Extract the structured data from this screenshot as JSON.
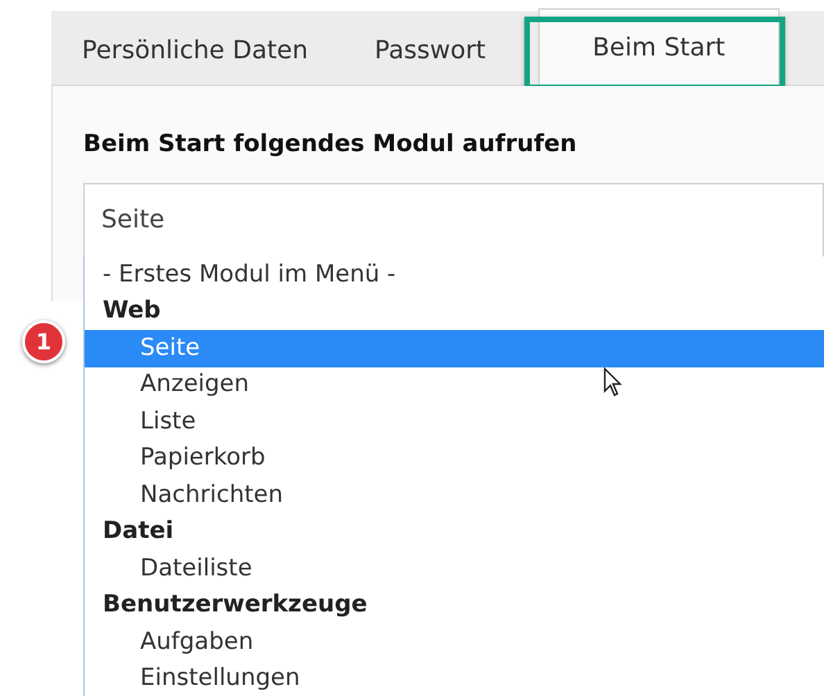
{
  "tabs": [
    {
      "label": "Persönliche Daten",
      "selected": false,
      "highlighted": false
    },
    {
      "label": "Passwort",
      "selected": false,
      "highlighted": false
    },
    {
      "label": "Beim Start",
      "selected": true,
      "highlighted": true
    }
  ],
  "field_label": "Beim Start folgendes Modul aufrufen",
  "select": {
    "value": "Seite",
    "expanded": true
  },
  "callout": "1",
  "options": [
    {
      "kind": "placeholder",
      "label": "- Erstes Modul im Menü -",
      "selected": false
    },
    {
      "kind": "group",
      "label": "Web",
      "selected": false
    },
    {
      "kind": "option",
      "label": "Seite",
      "selected": true
    },
    {
      "kind": "option",
      "label": "Anzeigen",
      "selected": false
    },
    {
      "kind": "option",
      "label": "Liste",
      "selected": false
    },
    {
      "kind": "option",
      "label": "Papierkorb",
      "selected": false
    },
    {
      "kind": "option",
      "label": "Nachrichten",
      "selected": false
    },
    {
      "kind": "group",
      "label": "Datei",
      "selected": false
    },
    {
      "kind": "option",
      "label": "Dateiliste",
      "selected": false
    },
    {
      "kind": "group",
      "label": "Benutzerwerkzeuge",
      "selected": false
    },
    {
      "kind": "option",
      "label": "Aufgaben",
      "selected": false
    },
    {
      "kind": "option",
      "label": "Einstellungen",
      "selected": false
    }
  ]
}
